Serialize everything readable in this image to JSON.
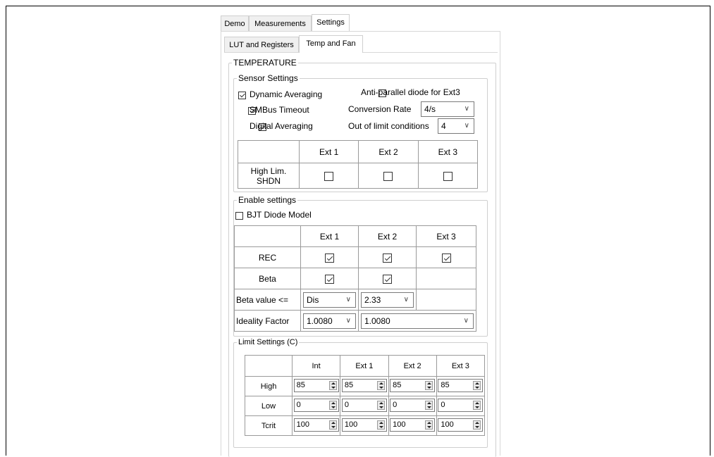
{
  "top_tabs": [
    "Demo",
    "Measurements",
    "Settings"
  ],
  "sub_tabs": [
    "LUT and Registers",
    "Temp and Fan"
  ],
  "temperature": {
    "title": "TEMPERATURE",
    "sensor": {
      "title": "Sensor Settings",
      "dynamic_averaging": {
        "label": "Dynamic Averaging",
        "checked": true
      },
      "smbus_timeout": {
        "label": "SMBus Timeout",
        "checked": true
      },
      "digital_averaging": {
        "label": "Digital Averaging",
        "checked": true
      },
      "anti_parallel": {
        "label": "Anti-parallel diode for Ext3",
        "checked": false
      },
      "conversion_rate_label": "Conversion Rate",
      "conversion_rate_value": "4/s",
      "out_of_limit_label": "Out of limit conditions",
      "out_of_limit_value": "4",
      "table": {
        "headers": [
          "",
          "Ext 1",
          "Ext 2",
          "Ext 3"
        ],
        "row_label_1": "High Lim.",
        "row_label_2": "SHDN",
        "checks": [
          false,
          false,
          false
        ]
      }
    },
    "enable": {
      "title": "Enable settings",
      "bjt": {
        "label": "BJT Diode Model",
        "checked": false
      },
      "headers": [
        "",
        "Ext 1",
        "Ext 2",
        "Ext 3"
      ],
      "rec_label": "REC",
      "rec_checks": [
        true,
        true,
        true
      ],
      "beta_label": "Beta",
      "beta_checks": [
        true,
        true
      ],
      "beta_value_label": "Beta value <=",
      "beta_value_ext1": "Dis",
      "beta_value_ext2": "2.33",
      "ideality_label": "Ideality Factor",
      "ideality_ext1": "1.0080",
      "ideality_ext2": "1.0080"
    },
    "limits": {
      "title": "Limit Settings (C)",
      "headers": [
        "",
        "Int",
        "Ext 1",
        "Ext 2",
        "Ext 3"
      ],
      "rows": [
        {
          "label": "High",
          "values": [
            "85",
            "85",
            "85",
            "85"
          ]
        },
        {
          "label": "Low",
          "values": [
            "0",
            "0",
            "0",
            "0"
          ]
        },
        {
          "label": "Tcrit",
          "values": [
            "100",
            "100",
            "100",
            "100"
          ]
        }
      ]
    }
  }
}
